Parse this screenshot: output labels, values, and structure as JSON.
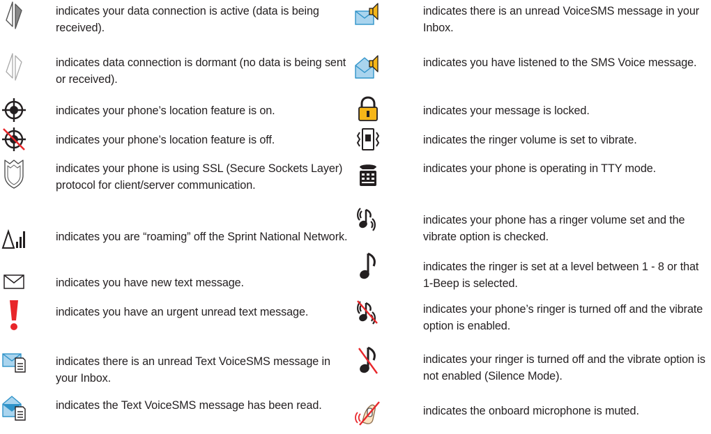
{
  "left_column": [
    {
      "icon": "data-active-icon",
      "text": "indicates your data connection is active (data is being received)."
    },
    {
      "icon": "data-dormant-icon",
      "text": "indicates data connection is dormant (no data is being sent or received)."
    },
    {
      "icon": "location-on-icon",
      "text": "indicates your phone’s location feature is on."
    },
    {
      "icon": "location-off-icon",
      "text": "indicates your phone’s location feature is off."
    },
    {
      "icon": "ssl-shield-icon",
      "text": "indicates your phone is using SSL (Secure Sockets Layer) protocol for client/server communication."
    },
    {
      "icon": "roaming-icon",
      "text": "indicates you are “roaming” off the Sprint National Network."
    },
    {
      "icon": "new-text-message-icon",
      "text": "indicates you have new text message."
    },
    {
      "icon": "urgent-message-icon",
      "text": "indicates you have an urgent unread text message."
    },
    {
      "icon": "unread-text-voicesms-icon",
      "text": "indicates there is an unread Text VoiceSMS message in your Inbox."
    },
    {
      "icon": "read-text-voicesms-icon",
      "text": "indicates the Text VoiceSMS message has been read."
    }
  ],
  "right_column": [
    {
      "icon": "unread-voicesms-icon",
      "text": "indicates there is an unread VoiceSMS message in your Inbox."
    },
    {
      "icon": "listened-voicesms-icon",
      "text": "indicates you have listened to the SMS Voice message."
    },
    {
      "icon": "lock-icon",
      "text": "indicates your message is locked."
    },
    {
      "icon": "vibrate-icon",
      "text": "indicates the ringer volume is set to vibrate."
    },
    {
      "icon": "tty-icon",
      "text": "indicates your phone is operating in TTY mode."
    },
    {
      "icon": "ringer-vibrate-icon",
      "text": "indicates your phone has a ringer volume set and the vibrate option is checked."
    },
    {
      "icon": "ringer-note-icon",
      "text": "indicates the ringer is set at a level between 1 - 8 or that 1-Beep is selected."
    },
    {
      "icon": "ringer-off-vibrate-icon",
      "text": "indicates your phone’s ringer is turned off and the vibrate option is enabled."
    },
    {
      "icon": "silence-mode-icon",
      "text": "indicates your ringer is turned off and the vibrate option is not enabled (Silence Mode)."
    },
    {
      "icon": "mic-muted-icon",
      "text": "indicates the onboard microphone is muted."
    }
  ],
  "colors": {
    "text": "#231f20",
    "accent_red": "#e8262a",
    "envelope_blue": "#2f93c9",
    "lock_yellow": "#f6b618"
  }
}
